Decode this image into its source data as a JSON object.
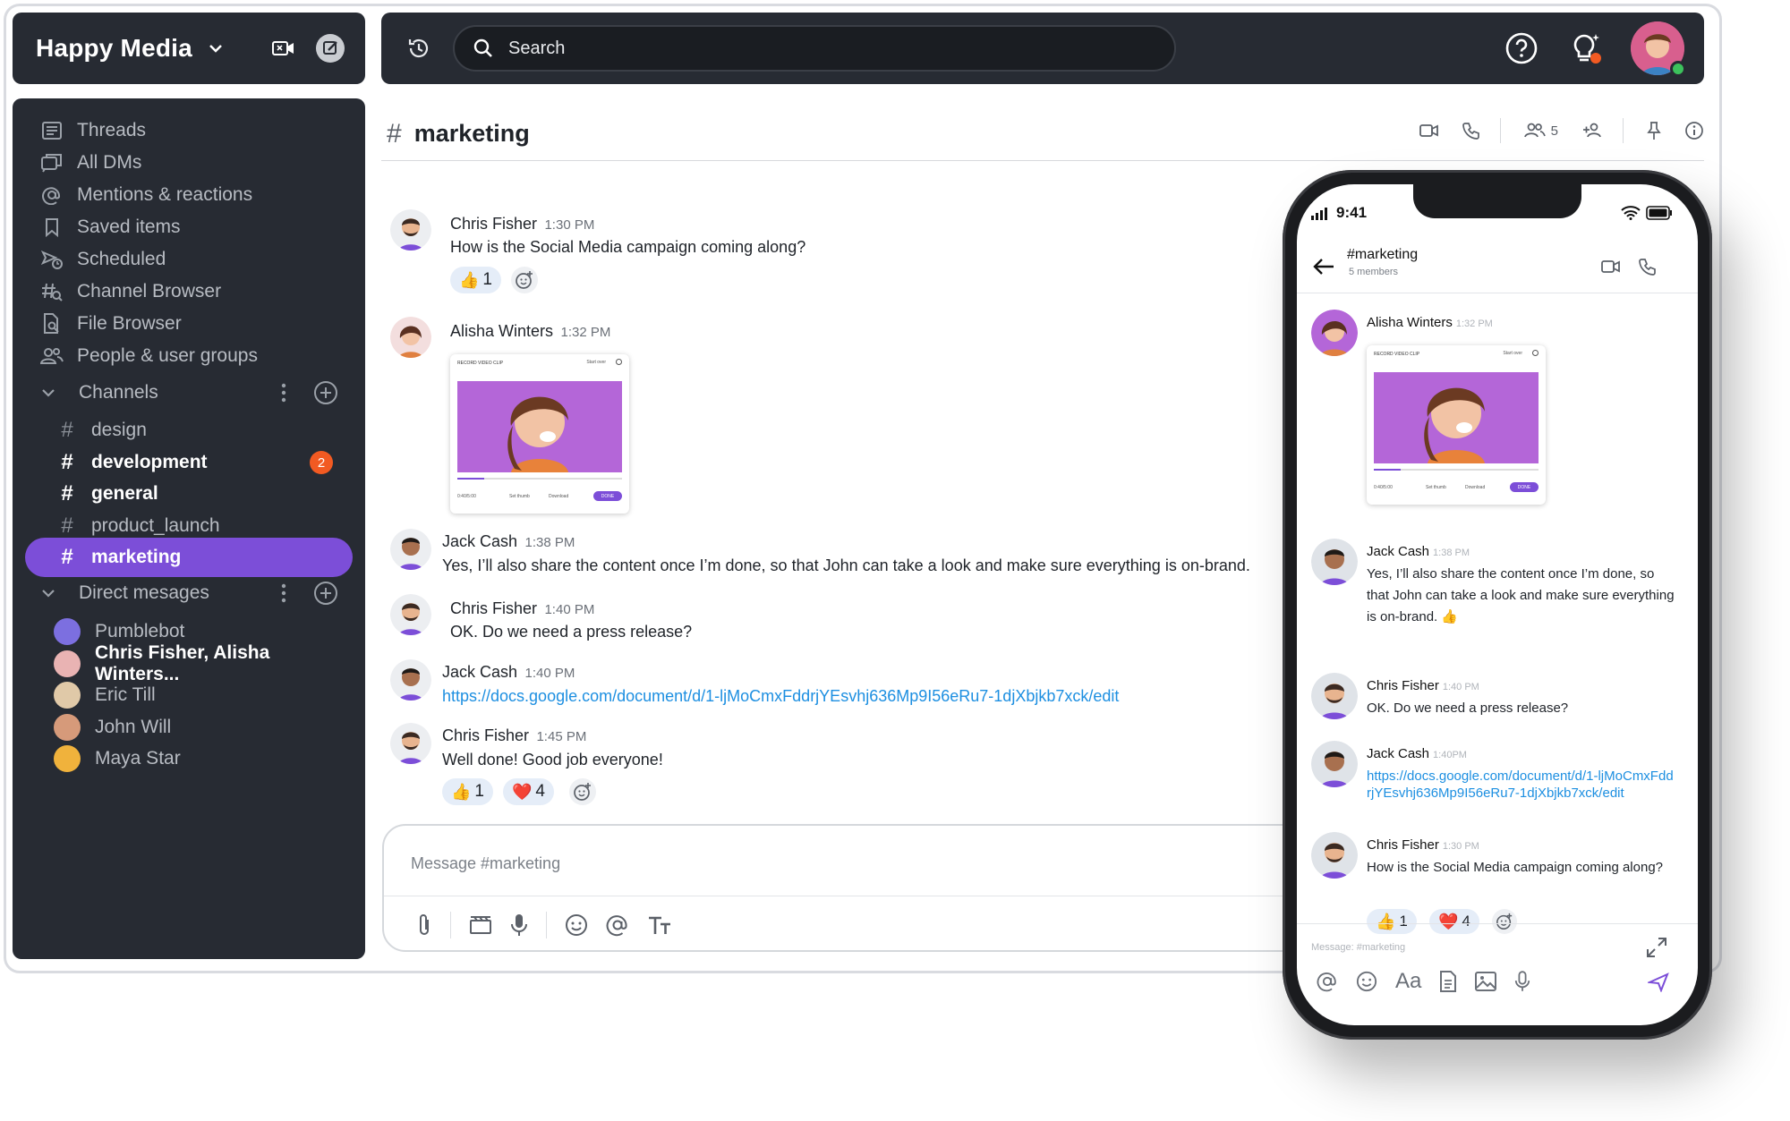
{
  "team": {
    "name": "Happy Media"
  },
  "search": {
    "placeholder": "Search"
  },
  "sidebar": {
    "nav": [
      {
        "label": "Threads",
        "icon": "threads-icon"
      },
      {
        "label": "All DMs",
        "icon": "dms-icon"
      },
      {
        "label": "Mentions & reactions",
        "icon": "at-icon"
      },
      {
        "label": "Saved items",
        "icon": "bookmark-icon"
      },
      {
        "label": "Scheduled",
        "icon": "scheduled-icon"
      },
      {
        "label": "Channel Browser",
        "icon": "channel-browser-icon"
      },
      {
        "label": "File Browser",
        "icon": "file-icon"
      },
      {
        "label": "People & user groups",
        "icon": "people-icon"
      }
    ],
    "channels_label": "Channels",
    "channels": [
      {
        "name": "design",
        "bold": false,
        "badge": ""
      },
      {
        "name": "development",
        "bold": true,
        "badge": "2"
      },
      {
        "name": "general",
        "bold": true,
        "badge": ""
      },
      {
        "name": "product_launch",
        "bold": false,
        "badge": ""
      },
      {
        "name": "marketing",
        "active": true,
        "badge": ""
      }
    ],
    "dms_label": "Direct mesages",
    "dms": [
      {
        "name": "Pumblebot",
        "bold": false,
        "color": "#7c6fe0"
      },
      {
        "name": "Chris Fisher, Alisha Winters...",
        "bold": true,
        "color": "#e9b3b3"
      },
      {
        "name": "Eric Till",
        "bold": false,
        "color": "#e0c9a8"
      },
      {
        "name": "John Will",
        "bold": false,
        "color": "#d69a7a"
      },
      {
        "name": "Maya Star",
        "bold": false,
        "color": "#f0b23c"
      }
    ]
  },
  "channel": {
    "name": "marketing",
    "member_count": "5"
  },
  "messages": [
    {
      "author": "Chris Fisher",
      "time": "1:30 PM",
      "text": "How is the Social Media campaign coming along?",
      "reactions": [
        {
          "emoji": "👍",
          "count": "1"
        }
      ]
    },
    {
      "author": "Alisha Winters",
      "time": "1:32 PM",
      "video": {
        "title": "RECORD VIDEO CLIP",
        "start_over": "Start over",
        "time": "0:40/5:00",
        "set_thumb": "Set thumb",
        "download": "Download",
        "done": "DONE"
      }
    },
    {
      "author": "Jack Cash",
      "time": "1:38 PM",
      "text": "Yes, I’ll also share the content once I’m done, so that John can take a look and make sure everything is on-brand."
    },
    {
      "author": "Chris Fisher",
      "time": "1:40 PM",
      "text": "OK. Do we need a press release?"
    },
    {
      "author": "Jack Cash",
      "time": "1:40 PM",
      "link": "https://docs.google.com/document/d/1-ljMoCmxFddrjYEsvhj636Mp9I56eRu7-1djXbjkb7xck/edit"
    },
    {
      "author": "Chris Fisher",
      "time": "1:45 PM",
      "text": "Well done! Good job everyone!",
      "reactions": [
        {
          "emoji": "👍",
          "count": "1"
        },
        {
          "emoji": "❤️",
          "count": "4"
        }
      ]
    }
  ],
  "composer": {
    "placeholder": "Message #marketing"
  },
  "phone": {
    "status_time": "9:41",
    "channel": "#marketing",
    "members": "5 members",
    "messages": [
      {
        "author": "Alisha Winters",
        "time": "1:32 PM"
      },
      {
        "author": "Jack Cash",
        "time": "1:38 PM",
        "text": "Yes, I’ll also share the content once I’m done, so that John can take a look and make sure everything is on-brand. 👍"
      },
      {
        "author": "Chris Fisher",
        "time": "1:40 PM",
        "text": "OK. Do we need a press release?"
      },
      {
        "author": "Jack Cash",
        "time": "1:40PM",
        "link": "https://docs.google.com/document/d/1-ljMoCmxFddrjYEsvhj636Mp9I56eRu7-1djXbjkb7xck/edit"
      },
      {
        "author": "Chris Fisher",
        "time": "1:30 PM",
        "text": "How is the Social Media campaign coming along?",
        "reactions": [
          {
            "emoji": "👍",
            "count": "1"
          },
          {
            "emoji": "❤️",
            "count": "4"
          }
        ]
      }
    ],
    "composer_placeholder": "Message: #marketing",
    "text_format_label": "Aa"
  },
  "colors": {
    "accent": "#7c4ed8",
    "badge": "#f25a22",
    "link": "#1d8fe1",
    "sidebar": "#272b33"
  }
}
